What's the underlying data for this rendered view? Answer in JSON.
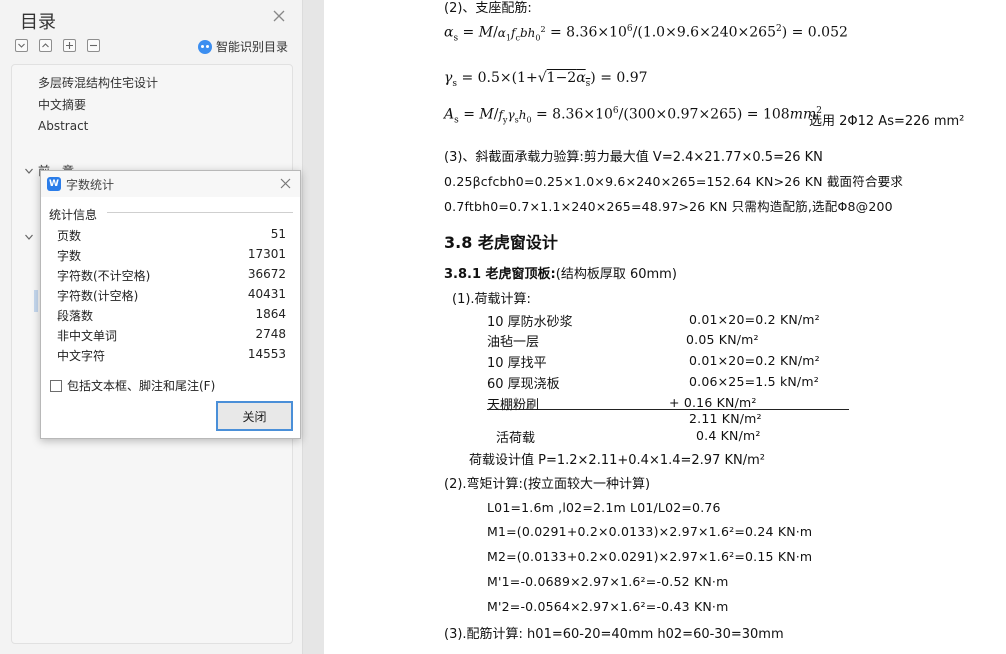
{
  "sidebar": {
    "title": "目录",
    "ai_label": "智能识别目录",
    "toc": [
      "多层砖混结构住宅设计",
      "中文摘要",
      "Abstract",
      "前一章"
    ],
    "toolbar_icons": [
      "expand-all-icon",
      "collapse-all-icon",
      "add-icon",
      "remove-icon"
    ]
  },
  "dialog": {
    "title": "字数统计",
    "section": "统计信息",
    "stats": [
      {
        "label": "页数",
        "value": "51"
      },
      {
        "label": "字数",
        "value": "17301"
      },
      {
        "label": "字符数(不计空格)",
        "value": "36672"
      },
      {
        "label": "字符数(计空格)",
        "value": "40431"
      },
      {
        "label": "段落数",
        "value": "1864"
      },
      {
        "label": "非中文单词",
        "value": "2748"
      },
      {
        "label": "中文字符",
        "value": "14553"
      }
    ],
    "checkbox_label": "包括文本框、脚注和尾注(F)",
    "close_label": "关闭"
  },
  "doc": {
    "l_support": "(2)、支座配筋:",
    "f1_lhs": "α_s = M/(α₁f_c b h₀²) = 8.36×10⁶/(1.0×9.6×240×265²) = 0.052",
    "f2": "γ_s = 0.5×(1+√(1−2α_s)) = 0.97",
    "f3": "A_s = M/(f_y γ_s h₀) = 8.36×10⁶/(300×0.97×265) = 108mm²",
    "f3_note": "选用 2Φ12    As=226 mm²",
    "l_shear": "(3)、斜截面承载力验算:剪力最大值 V=2.4×21.77×0.5=26 KN",
    "l_shear2": "0.25βcfcbh0=0.25×1.0×9.6×240×265=152.64 KN>26 KN   截面符合要求",
    "l_shear3": "0.7ftbh0=0.7×1.1×240×265=48.97>26 KN   只需构造配筋,选配Φ8@200",
    "h_38": "3.8 老虎窗设计",
    "h_381": "3.8.1 老虎窗顶板:",
    "h_381_rest": "(结构板厚取 60mm)",
    "load_title": "(1).荷载计算:",
    "loads": [
      {
        "name": "10 厚防水砂浆",
        "value": "0.01×20=0.2 KN/m²"
      },
      {
        "name": "油毡一层",
        "value": "0.05 KN/m²"
      },
      {
        "name": "10 厚找平",
        "value": "0.01×20=0.2 KN/m²"
      },
      {
        "name": "60 厚现浇板",
        "value": "0.06×25=1.5 kN/m²"
      },
      {
        "name": "天棚粉刷",
        "value": "+   0.16 KN/m²"
      }
    ],
    "sum": "2.11 KN/m²",
    "live_name": "活荷载",
    "live_value": "0.4 KN/m²",
    "design": "荷载设计值 P=1.2×2.11+0.4×1.4=2.97 KN/m²",
    "moment_title": "(2).弯矩计算:(按立面较大一种计算)",
    "m1": "L01=1.6m ,l02=2.1m   L01/L02=0.76",
    "m2": "M1=(0.0291+0.2×0.0133)×2.97×1.6²=0.24 KN·m",
    "m3": "M2=(0.0133+0.2×0.0291)×2.97×1.6²=0.15 KN·m",
    "m4": "M'1=-0.0689×2.97×1.6²=-0.52 KN·m",
    "m5": "M'2=-0.0564×2.97×1.6²=-0.43 KN·m",
    "reinf": "(3).配筋计算: h01=60-20=40mm      h02=60-30=30mm"
  }
}
